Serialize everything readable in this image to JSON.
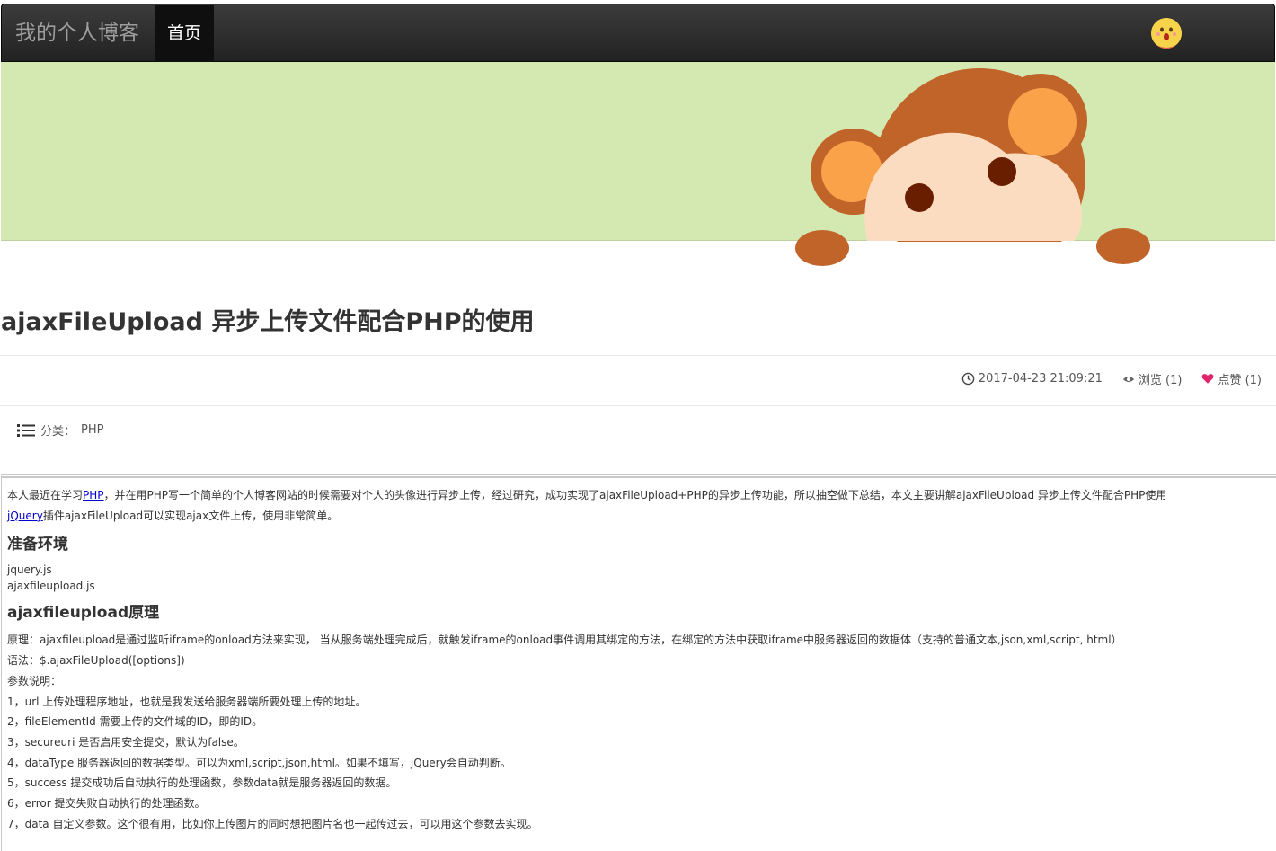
{
  "navbar": {
    "brand": "我的个人博客",
    "home": "首页"
  },
  "post": {
    "title": "ajaxFileUpload 异步上传文件配合PHP的使用",
    "date": "2017-04-23 21:09:21",
    "views": "浏览 (1)",
    "likes": "点赞 (1)",
    "category_label": "分类：",
    "category_value": "PHP"
  },
  "article": {
    "p1_pre": "本人最近在学习",
    "p1_link": "PHP",
    "p1_post": "，并在用PHP写一个简单的个人博客网站的时候需要对个人的头像进行异步上传，经过研究，成功实现了ajaxFileUpload+PHP的异步上传功能，所以抽空做下总结，本文主要讲解ajaxFileUpload 异步上传文件配合PHP使用",
    "p2_link": "jQuery",
    "p2_post": "插件ajaxFileUpload可以实现ajax文件上传，使用非常简单。",
    "h_env": "准备环境",
    "env_1": "jquery.js",
    "env_2": "ajaxfileupload.js",
    "h_principle": "ajaxfileupload原理",
    "principle": "原理：ajaxfileupload是通过监听iframe的onload方法来实现， 当从服务端处理完成后，就触发iframe的onload事件调用其绑定的方法，在绑定的方法中获取iframe中服务器返回的数据体（支持的普通文本,json,xml,script, html）",
    "syntax": "语法：$.ajaxFileUpload([options])",
    "params_title": "参数说明：",
    "param_1": "1，url 上传处理程序地址，也就是我发送给服务器端所要处理上传的地址。",
    "param_2": "2，fileElementId 需要上传的文件域的ID，即的ID。",
    "param_3": "3，secureuri 是否启用安全提交，默认为false。",
    "param_4": "4，dataType 服务器返回的数据类型。可以为xml,script,json,html。如果不填写，jQuery会自动判断。",
    "param_5": "5，success 提交成功后自动执行的处理函数，参数data就是服务器返回的数据。",
    "param_6": "6，error 提交失败自动执行的处理函数。",
    "param_7": "7，data 自定义参数。这个很有用，比如你上传图片的同时想把图片名也一起传过去，可以用这个参数去实现。"
  },
  "colors": {
    "navbar_bg": "#222222",
    "banner_bg": "#d3e9b1",
    "link": "#0000cc",
    "heart": "#e0246b"
  }
}
